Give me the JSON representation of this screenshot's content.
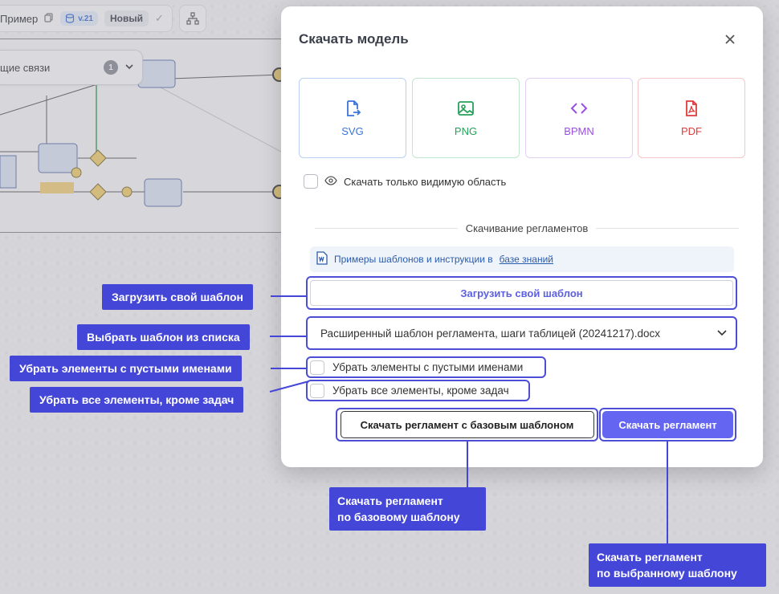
{
  "app": {
    "model_name": "Пример",
    "version": "v.21",
    "status": "Новый",
    "links_panel_label": "щие связи",
    "links_count": "1"
  },
  "dialog": {
    "title": "Скачать модель",
    "formats": [
      {
        "label": "SVG",
        "icon": "svg-file-icon",
        "color": "#3b74d9",
        "border": "#b9d0f2"
      },
      {
        "label": "PNG",
        "icon": "image-icon",
        "color": "#27a05a",
        "border": "#bfe8cf"
      },
      {
        "label": "BPMN",
        "icon": "code-icon",
        "color": "#9a4fe0",
        "border": "#e1cff6"
      },
      {
        "label": "PDF",
        "icon": "pdf-icon",
        "color": "#e03b3b",
        "border": "#f5c8c8"
      }
    ],
    "visible_only_label": "Скачать только видимую область",
    "regulations_section_label": "Скачивание регламентов",
    "info_text": "Примеры шаблонов и инструкции в",
    "info_link": "базе знаний",
    "upload_template_label": "Загрузить свой шаблон",
    "selected_template": "Расширенный шаблон регламента, шаги таблицей (20241217).docx",
    "remove_empty_label": "Убрать элементы с пустыми именами",
    "remove_non_tasks_label": "Убрать все элементы, кроме задач",
    "download_base_label": "Скачать регламент с базовым шаблоном",
    "download_label": "Скачать регламент"
  },
  "annotations": {
    "upload": "Загрузить свой шаблон",
    "choose": "Выбрать шаблон из списка",
    "remove_empty": "Убрать элементы с пустыми именами",
    "remove_non_tasks": "Убрать все элементы, кроме задач",
    "base_line1": "Скачать регламент",
    "base_line2": "по базовому шаблону",
    "selected_line1": "Скачать регламент",
    "selected_line2": "по выбранному шаблону"
  },
  "colors": {
    "accent": "#6466f1",
    "annotation": "#4446d8"
  }
}
